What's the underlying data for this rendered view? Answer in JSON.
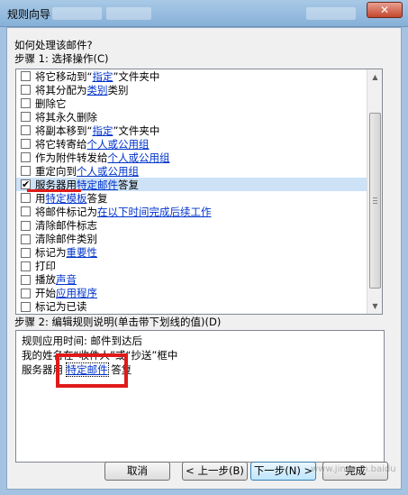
{
  "window": {
    "title": "规则向导",
    "close_glyph": "✕"
  },
  "prompt": "如何处理该邮件?",
  "step1": {
    "label": "步骤 1: 选择操作(C)",
    "items": [
      {
        "pre": "将它移动到“",
        "link": "指定",
        "post": "”文件夹中",
        "checked": false,
        "selected": false
      },
      {
        "pre": "将其分配为 ",
        "link": "类别",
        "post": " 类别",
        "checked": false,
        "selected": false
      },
      {
        "pre": "删除它",
        "link": "",
        "post": "",
        "checked": false,
        "selected": false
      },
      {
        "pre": "将其永久删除",
        "link": "",
        "post": "",
        "checked": false,
        "selected": false
      },
      {
        "pre": "将副本移到“",
        "link": "指定",
        "post": "”文件夹中",
        "checked": false,
        "selected": false
      },
      {
        "pre": "将它转寄给 ",
        "link": "个人或公用组",
        "post": "",
        "checked": false,
        "selected": false
      },
      {
        "pre": "作为附件转发给 ",
        "link": "个人或公用组",
        "post": "",
        "checked": false,
        "selected": false
      },
      {
        "pre": "重定向到 ",
        "link": "个人或公用组",
        "post": "",
        "checked": false,
        "selected": false
      },
      {
        "pre": "服务器用 ",
        "link": "特定邮件",
        "post": " 答复",
        "checked": true,
        "selected": true
      },
      {
        "pre": "用 ",
        "link": "特定模板",
        "post": " 答复",
        "checked": false,
        "selected": false
      },
      {
        "pre": "将邮件标记为 ",
        "link": "在以下时间完成后续工作",
        "post": "",
        "checked": false,
        "selected": false
      },
      {
        "pre": "清除邮件标志",
        "link": "",
        "post": "",
        "checked": false,
        "selected": false
      },
      {
        "pre": "清除邮件类别",
        "link": "",
        "post": "",
        "checked": false,
        "selected": false
      },
      {
        "pre": "标记为 ",
        "link": "重要性",
        "post": "",
        "checked": false,
        "selected": false
      },
      {
        "pre": "打印",
        "link": "",
        "post": "",
        "checked": false,
        "selected": false
      },
      {
        "pre": "播放 ",
        "link": "声音",
        "post": "",
        "checked": false,
        "selected": false
      },
      {
        "pre": "开始 ",
        "link": "应用程序",
        "post": "",
        "checked": false,
        "selected": false
      },
      {
        "pre": "标记为已读",
        "link": "",
        "post": "",
        "checked": false,
        "selected": false
      }
    ]
  },
  "step2": {
    "label": "步骤 2: 编辑规则说明(单击带下划线的值)(D)",
    "line1": "规则应用时间: 邮件到达后",
    "line2": "我的姓名在“收件人”或“抄送”框中",
    "line3_pre": "服务器用 ",
    "line3_link": "特定邮件",
    "line3_post": " 答复"
  },
  "buttons": {
    "cancel": "取消",
    "back": "< 上一步(B)",
    "next": "下一步(N) >",
    "finish": "完成"
  },
  "watermark": "www.jingyan.baidu"
}
